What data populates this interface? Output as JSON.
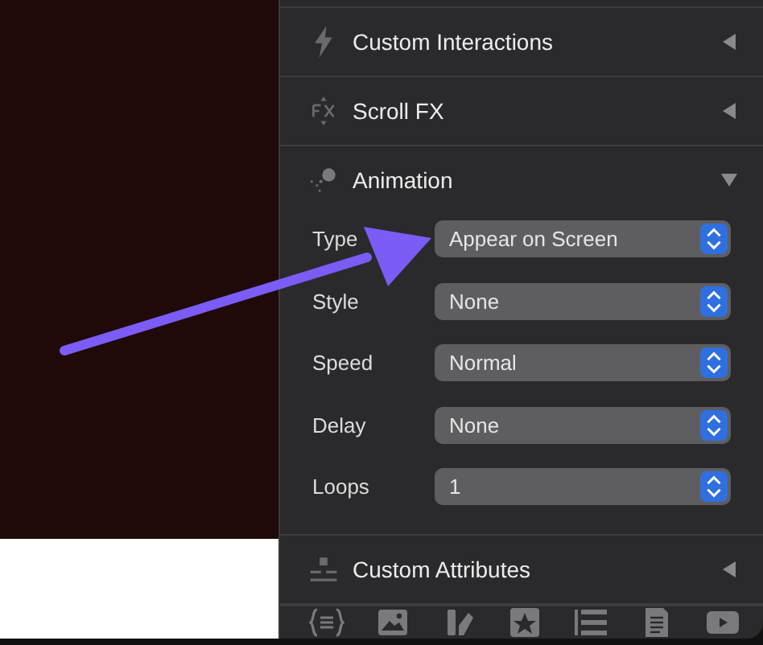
{
  "sections": [
    {
      "title": "Custom Interactions",
      "expanded": false
    },
    {
      "title": "Scroll FX",
      "expanded": false
    },
    {
      "title": "Animation",
      "expanded": true,
      "fields": [
        {
          "label": "Type",
          "value": "Appear on Screen"
        },
        {
          "label": "Style",
          "value": "None"
        },
        {
          "label": "Speed",
          "value": "Normal"
        },
        {
          "label": "Delay",
          "value": "None"
        },
        {
          "label": "Loops",
          "value": "1"
        }
      ]
    },
    {
      "title": "Custom Attributes",
      "expanded": false
    }
  ]
}
